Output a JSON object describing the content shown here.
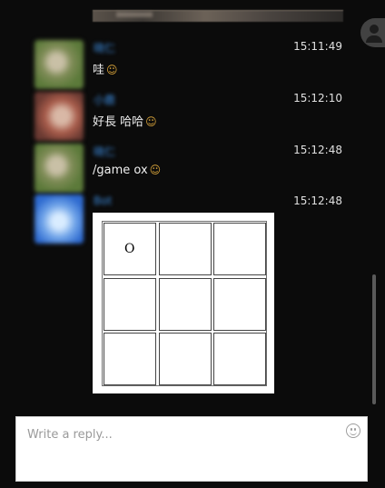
{
  "messages": [
    {
      "username": "晓仁",
      "timestamp": "15:11:49",
      "text": "哇",
      "emoji": "☺"
    },
    {
      "username": "小鹿",
      "timestamp": "15:12:10",
      "text": "好長 哈哈",
      "emoji": "☺"
    },
    {
      "username": "晓仁",
      "timestamp": "15:12:48",
      "text": "/game ox",
      "emoji": "☺"
    },
    {
      "username": "Bot",
      "timestamp": "15:12:48"
    }
  ],
  "game": {
    "cells": [
      "O",
      "",
      "",
      "",
      "",
      "",
      "",
      "",
      ""
    ]
  },
  "reply": {
    "placeholder": "Write a reply...",
    "value": ""
  },
  "colors": {
    "background": "#0b0b0b",
    "username": "#3d8de0",
    "emoji": "#d6a23a"
  }
}
